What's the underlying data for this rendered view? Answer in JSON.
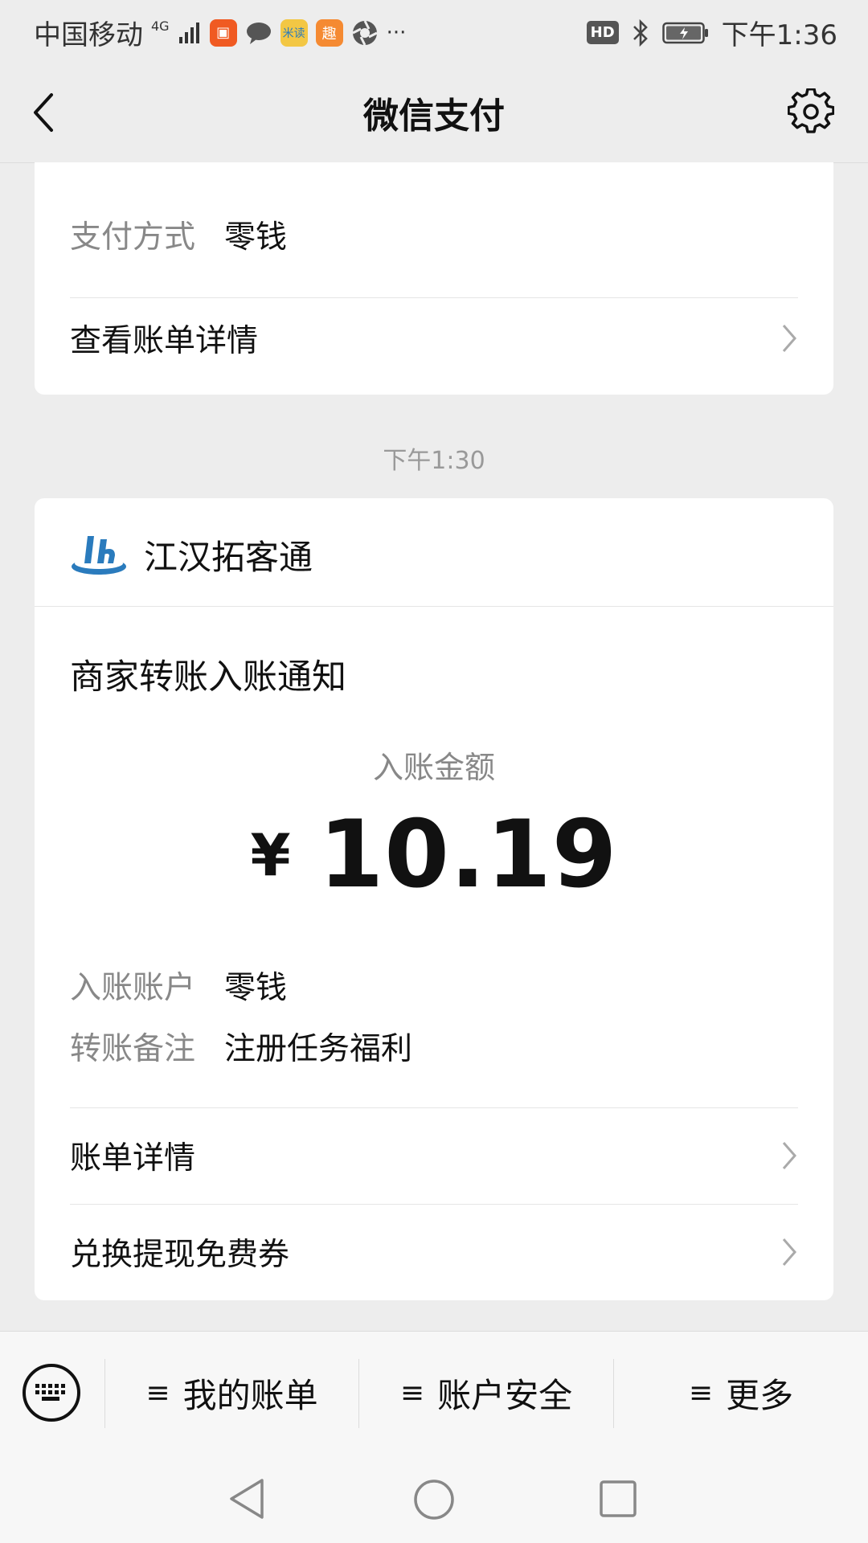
{
  "status_bar": {
    "carrier": "中国移动",
    "network": "4G",
    "time": "下午1:36",
    "hd": "HD",
    "app_icons": [
      "kuaishou-icon",
      "wechat-bubble-icon",
      "miduo-icon",
      "qu-icon",
      "aperture-icon"
    ],
    "overflow": "···"
  },
  "header": {
    "title": "微信支付"
  },
  "card1": {
    "pay_method_label": "支付方式",
    "pay_method_value": "零钱",
    "view_bill": "查看账单详情"
  },
  "timestamp": "下午1:30",
  "card2": {
    "merchant_name": "江汉拓客通",
    "notice_title": "商家转账入账通知",
    "amount_label": "入账金额",
    "currency": "¥",
    "amount": "10.19",
    "account_label": "入账账户",
    "account_value": "零钱",
    "memo_label": "转账备注",
    "memo_value": "注册任务福利",
    "bill_details": "账单详情",
    "coupon": "兑换提现免费券"
  },
  "bottom_menu": {
    "items": [
      "我的账单",
      "账户安全",
      "更多"
    ],
    "ham": "≡"
  },
  "colors": {
    "bg": "#ededed",
    "card": "#ffffff",
    "muted": "#888888",
    "logo_blue": "#2a7bbd"
  }
}
